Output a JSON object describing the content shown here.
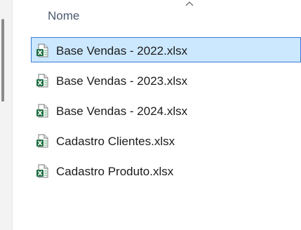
{
  "header": {
    "column_name": "Nome",
    "sort_icon": "chevron-up-icon"
  },
  "files": [
    {
      "name": "Base Vendas - 2022.xlsx",
      "icon": "excel-file-icon",
      "selected": true
    },
    {
      "name": "Base Vendas - 2023.xlsx",
      "icon": "excel-file-icon",
      "selected": false
    },
    {
      "name": "Base Vendas - 2024.xlsx",
      "icon": "excel-file-icon",
      "selected": false
    },
    {
      "name": "Cadastro Clientes.xlsx",
      "icon": "excel-file-icon",
      "selected": false
    },
    {
      "name": "Cadastro Produto.xlsx",
      "icon": "excel-file-icon",
      "selected": false
    }
  ],
  "colors": {
    "selection_bg": "#cce8ff",
    "selection_border": "#3a7bd5",
    "excel_green": "#1d6f42"
  }
}
